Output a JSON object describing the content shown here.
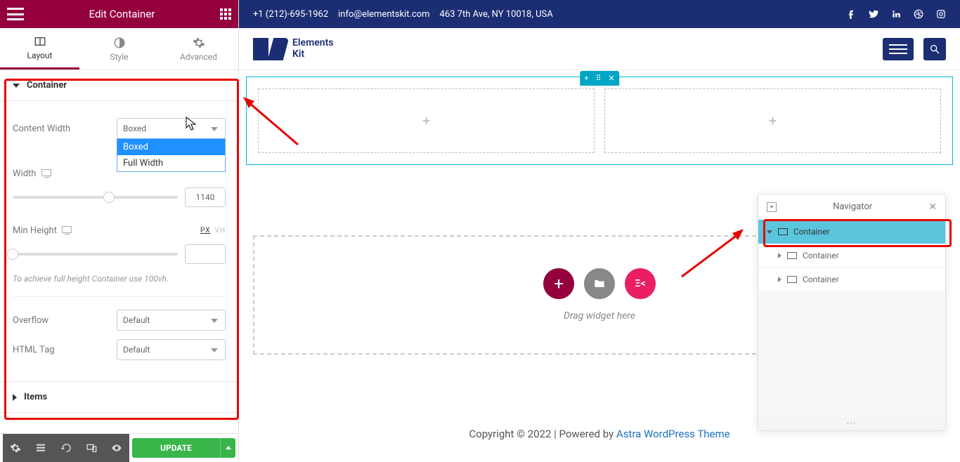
{
  "leftPanel": {
    "title": "Edit Container",
    "tabs": {
      "layout": "Layout",
      "style": "Style",
      "advanced": "Advanced"
    },
    "sections": {
      "container": "Container",
      "items": "Items"
    },
    "controls": {
      "contentWidth": {
        "label": "Content Width",
        "value": "Boxed",
        "options": [
          "Boxed",
          "Full Width"
        ]
      },
      "width": {
        "label": "Width",
        "value": "1140"
      },
      "minHeight": {
        "label": "Min Height",
        "value": "",
        "units": [
          "PX",
          "VH"
        ]
      },
      "hint": "To achieve full height Container use 100vh.",
      "overflow": {
        "label": "Overflow",
        "value": "Default"
      },
      "htmlTag": {
        "label": "HTML Tag",
        "value": "Default"
      }
    },
    "update": "UPDATE"
  },
  "topbar": {
    "phone": "+1 (212)-695-1962",
    "email": "info@elementskit.com",
    "address": "463 7th Ave, NY 10018, USA"
  },
  "siteHeader": {
    "logoLine1": "Elements",
    "logoLine2": "Kit"
  },
  "canvas": {
    "dragText": "Drag widget here"
  },
  "navigator": {
    "title": "Navigator",
    "items": [
      "Container",
      "Container",
      "Container"
    ]
  },
  "footer": {
    "text": "Copyright © 2022 | Powered by ",
    "link": "Astra WordPress Theme"
  }
}
